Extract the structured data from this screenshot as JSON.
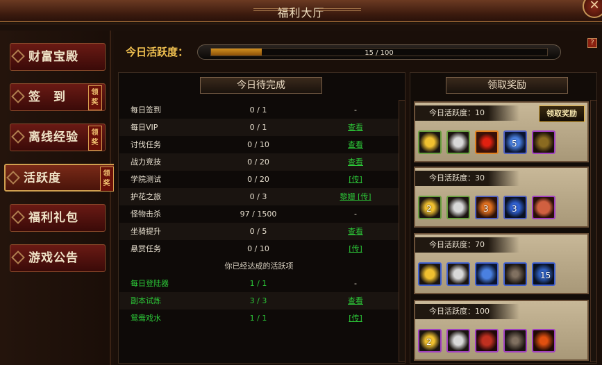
{
  "window": {
    "title": "福利大厅"
  },
  "sidebar": {
    "items": [
      {
        "label": "财富宝殿",
        "badge": ""
      },
      {
        "label": "签　到",
        "badge": "领奖"
      },
      {
        "label": "离线经验",
        "badge": "领奖"
      },
      {
        "label": "活跃度",
        "badge": "领奖",
        "active": true
      },
      {
        "label": "福利礼包",
        "badge": ""
      },
      {
        "label": "游戏公告",
        "badge": ""
      }
    ]
  },
  "activity": {
    "label": "今日活跃度：",
    "progress_text": "15 / 100",
    "progress_value": 15,
    "progress_max": 100
  },
  "todo": {
    "header": "今日待完成",
    "rows": [
      {
        "name": "每日签到",
        "count": "0 / 1",
        "action": "-"
      },
      {
        "name": "每日VIP",
        "count": "0 / 1",
        "action": "查看"
      },
      {
        "name": "讨伐任务",
        "count": "0 / 10",
        "action": "查看"
      },
      {
        "name": "战力竞技",
        "count": "0 / 20",
        "action": "查看"
      },
      {
        "name": "学院测试",
        "count": "0 / 20",
        "action": "[传]"
      },
      {
        "name": "护花之旅",
        "count": "0 / 3",
        "action": "黎姗 [传]"
      },
      {
        "name": "怪物击杀",
        "count": "97 / 1500",
        "action": "-"
      },
      {
        "name": "坐骑提升",
        "count": "0 / 5",
        "action": "查看"
      },
      {
        "name": "悬赏任务",
        "count": "0 / 10",
        "action": "[传]"
      }
    ],
    "done_header": "你已经达成的活跃项",
    "done_rows": [
      {
        "name": "每日登陆器",
        "count": "1 / 1",
        "action": "-"
      },
      {
        "name": "副本试炼",
        "count": "3 / 3",
        "action": "查看"
      },
      {
        "name": "鸳鸯戏水",
        "count": "1 / 1",
        "action": "[传]"
      }
    ]
  },
  "rewards": {
    "header": "领取奖励",
    "claim_label": "领取奖励",
    "tiers": [
      {
        "label": "今日活跃度：10",
        "items": [
          {
            "icon": "gold-ingot-icon",
            "qty": "",
            "border": "#6aa040"
          },
          {
            "icon": "silver-ingot-icon",
            "qty": "",
            "border": "#6aa040"
          },
          {
            "icon": "red-orb-icon",
            "qty": "",
            "border": "#e08020"
          },
          {
            "icon": "blue-potion-icon",
            "qty": "5",
            "border": "#5060c0"
          },
          {
            "icon": "horn-icon",
            "qty": "",
            "border": "#a040c0"
          }
        ]
      },
      {
        "label": "今日活跃度：30",
        "items": [
          {
            "icon": "gold-ingot-icon",
            "qty": "2",
            "border": "#6aa040"
          },
          {
            "icon": "silver-ingot-icon",
            "qty": "",
            "border": "#6aa040"
          },
          {
            "icon": "fire-pouch-icon",
            "qty": "3",
            "border": "#5060c0"
          },
          {
            "icon": "blue-scroll-icon",
            "qty": "3",
            "border": "#5060c0"
          },
          {
            "icon": "red-pearl-icon",
            "qty": "",
            "border": "#a040c0"
          }
        ]
      },
      {
        "label": "今日活跃度：70",
        "items": [
          {
            "icon": "gold-ingot-icon",
            "qty": "",
            "border": "#4060d0"
          },
          {
            "icon": "silver-ingot-icon",
            "qty": "",
            "border": "#4060d0"
          },
          {
            "icon": "blue-potion-icon",
            "qty": "",
            "border": "#4060d0"
          },
          {
            "icon": "shovel-icon",
            "qty": "",
            "border": "#4060d0"
          },
          {
            "icon": "blue-orb-icon",
            "qty": "15",
            "border": "#4060d0"
          }
        ]
      },
      {
        "label": "今日活跃度：100",
        "items": [
          {
            "icon": "gold-ingot-icon",
            "qty": "2",
            "border": "#a040c0"
          },
          {
            "icon": "silver-ingot-icon",
            "qty": "",
            "border": "#a040c0"
          },
          {
            "icon": "red-pouch-icon",
            "qty": "",
            "border": "#a040c0"
          },
          {
            "icon": "shovel-icon",
            "qty": "",
            "border": "#a040c0"
          },
          {
            "icon": "fire-wheel-icon",
            "qty": "",
            "border": "#a040c0"
          }
        ]
      }
    ]
  },
  "help_label": "?",
  "close_label": "✕"
}
